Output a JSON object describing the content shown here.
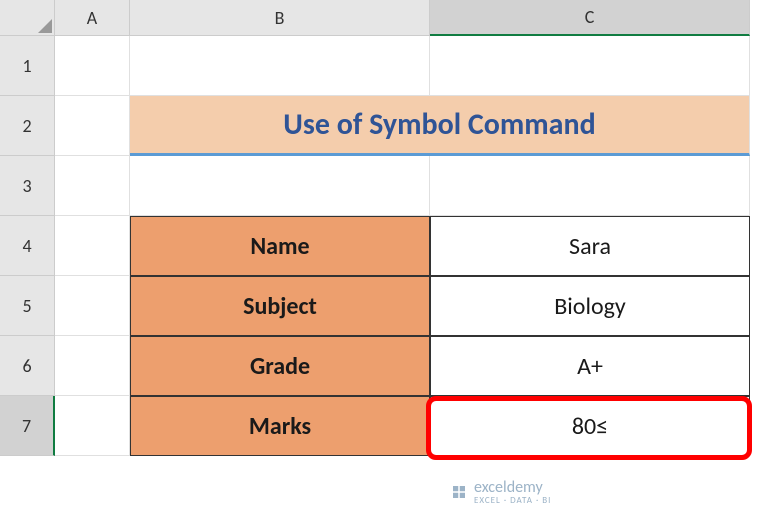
{
  "columns": {
    "A": "A",
    "B": "B",
    "C": "C"
  },
  "rows": {
    "r1": "1",
    "r2": "2",
    "r3": "3",
    "r4": "4",
    "r5": "5",
    "r6": "6",
    "r7": "7"
  },
  "title": "Use of Symbol Command",
  "table": {
    "name_label": "Name",
    "name_value": "Sara",
    "subject_label": "Subject",
    "subject_value": "Biology",
    "grade_label": "Grade",
    "grade_value": "A+",
    "marks_label": "Marks",
    "marks_value": "80≤"
  },
  "watermark": {
    "name": "exceldemy",
    "tagline": "EXCEL · DATA · BI"
  },
  "colors": {
    "title_bg": "#f4cdac",
    "title_text": "#2f5496",
    "label_bg": "#ed9f6e",
    "highlight": "#ff0000",
    "selected_accent": "#107c41"
  },
  "chart_data": {
    "type": "table",
    "title": "Use of Symbol Command",
    "rows": [
      {
        "label": "Name",
        "value": "Sara"
      },
      {
        "label": "Subject",
        "value": "Biology"
      },
      {
        "label": "Grade",
        "value": "A+"
      },
      {
        "label": "Marks",
        "value": "80≤"
      }
    ]
  }
}
